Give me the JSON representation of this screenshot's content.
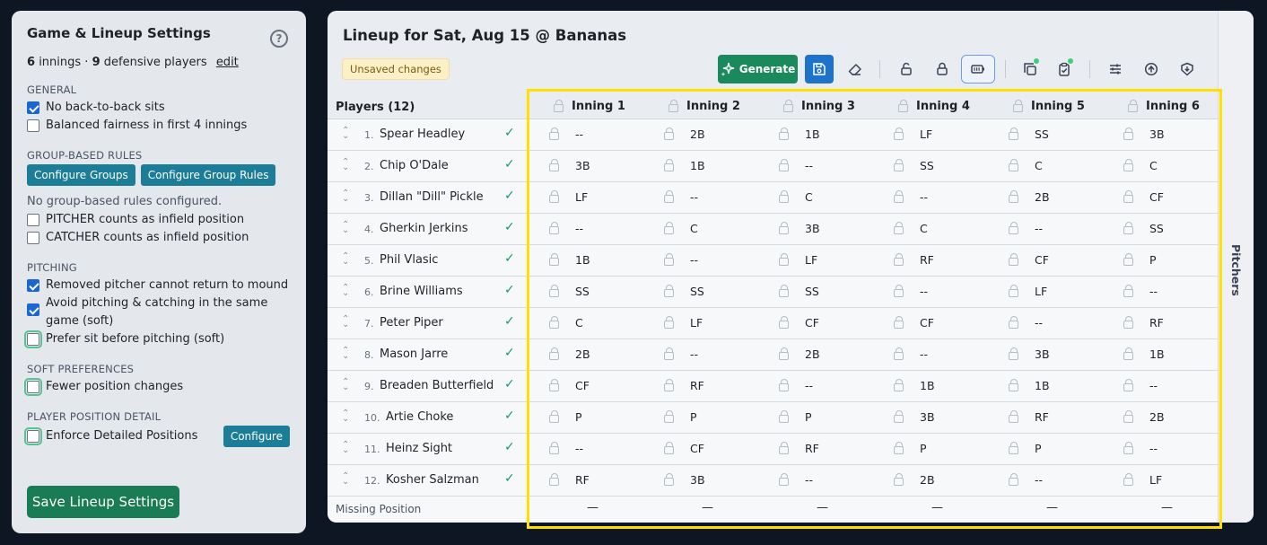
{
  "settings": {
    "title": "Game & Lineup Settings",
    "help_icon": "?",
    "summary_innings": "6",
    "summary_innings_label": "innings ·",
    "summary_players": "9",
    "summary_players_label": "defensive players",
    "edit_label": "edit",
    "general": {
      "label": "GENERAL",
      "options": [
        {
          "label": "No back-to-back sits",
          "checked": true
        },
        {
          "label": "Balanced fairness in first 4 innings",
          "checked": false
        }
      ]
    },
    "group_rules": {
      "label": "GROUP-BASED RULES",
      "configure_groups": "Configure Groups",
      "configure_group_rules": "Configure Group Rules",
      "none_text": "No group-based rules configured.",
      "options": [
        {
          "label": "PITCHER counts as infield position",
          "checked": false
        },
        {
          "label": "CATCHER counts as infield position",
          "checked": false
        }
      ]
    },
    "pitching": {
      "label": "PITCHING",
      "options": [
        {
          "label": "Removed pitcher cannot return to mound",
          "checked": true
        },
        {
          "label": "Avoid pitching & catching in the same game (soft)",
          "checked": true
        },
        {
          "label": "Prefer sit before pitching (soft)",
          "checked": false
        }
      ]
    },
    "soft": {
      "label": "SOFT PREFERENCES",
      "options": [
        {
          "label": "Fewer position changes",
          "checked": false
        }
      ]
    },
    "position_detail": {
      "label": "PLAYER POSITION DETAIL",
      "option": "Enforce Detailed Positions",
      "configure": "Configure"
    },
    "save_label": "Save Lineup Settings"
  },
  "lineup": {
    "title": "Lineup for Sat, Aug 15 @ Bananas",
    "unsaved": "Unsaved changes",
    "generate_label": "Generate",
    "pitchers_tab": "Pitchers",
    "players_header": "Players (12)",
    "innings": [
      "Inning 1",
      "Inning 2",
      "Inning 3",
      "Inning 4",
      "Inning 5",
      "Inning 6"
    ],
    "players": [
      {
        "num": "1.",
        "name": "Spear Headley",
        "pos": [
          "--",
          "2B",
          "1B",
          "LF",
          "SS",
          "3B"
        ]
      },
      {
        "num": "2.",
        "name": "Chip O'Dale",
        "pos": [
          "3B",
          "1B",
          "--",
          "SS",
          "C",
          "C"
        ]
      },
      {
        "num": "3.",
        "name": "Dillan \"Dill\" Pickle",
        "pos": [
          "LF",
          "--",
          "C",
          "--",
          "2B",
          "CF"
        ]
      },
      {
        "num": "4.",
        "name": "Gherkin Jerkins",
        "pos": [
          "--",
          "C",
          "3B",
          "C",
          "--",
          "SS"
        ]
      },
      {
        "num": "5.",
        "name": "Phil Vlasic",
        "pos": [
          "1B",
          "--",
          "LF",
          "RF",
          "CF",
          "P"
        ]
      },
      {
        "num": "6.",
        "name": "Brine Williams",
        "pos": [
          "SS",
          "SS",
          "SS",
          "--",
          "LF",
          "--"
        ]
      },
      {
        "num": "7.",
        "name": "Peter Piper",
        "pos": [
          "C",
          "LF",
          "CF",
          "CF",
          "--",
          "RF"
        ]
      },
      {
        "num": "8.",
        "name": "Mason Jarre",
        "pos": [
          "2B",
          "--",
          "2B",
          "--",
          "3B",
          "1B"
        ]
      },
      {
        "num": "9.",
        "name": "Breaden Butterfield",
        "pos": [
          "CF",
          "RF",
          "--",
          "1B",
          "1B",
          "--"
        ]
      },
      {
        "num": "10.",
        "name": "Artie Choke",
        "pos": [
          "P",
          "P",
          "P",
          "3B",
          "RF",
          "2B"
        ]
      },
      {
        "num": "11.",
        "name": "Heinz Sight",
        "pos": [
          "--",
          "CF",
          "RF",
          "P",
          "P",
          "--"
        ]
      },
      {
        "num": "12.",
        "name": "Kosher Salzman",
        "pos": [
          "RF",
          "3B",
          "--",
          "2B",
          "--",
          "LF"
        ]
      }
    ],
    "missing_label": "Missing Position",
    "missing_values": [
      "—",
      "—",
      "—",
      "—",
      "—",
      "—"
    ]
  },
  "icons": {
    "check": "✓",
    "handle_up": "⌃",
    "handle_down": "⌄",
    "generate": "sparkle-icon",
    "save": "floppy-icon",
    "eraser": "eraser-icon",
    "unlock": "unlock-icon",
    "lock": "lock-icon",
    "battery": "battery-icon",
    "copy": "copy-icon",
    "clipboard": "clipboard-check-icon",
    "sliders": "sliders-icon",
    "upload": "upload-icon",
    "download": "download-icon"
  },
  "colors": {
    "generate": "#1a8a5c",
    "save": "#1d72c9",
    "teal": "#1c7d99",
    "save_settings": "#1a7c55",
    "highlight": "#ffe100",
    "check": "#1a9a62"
  }
}
